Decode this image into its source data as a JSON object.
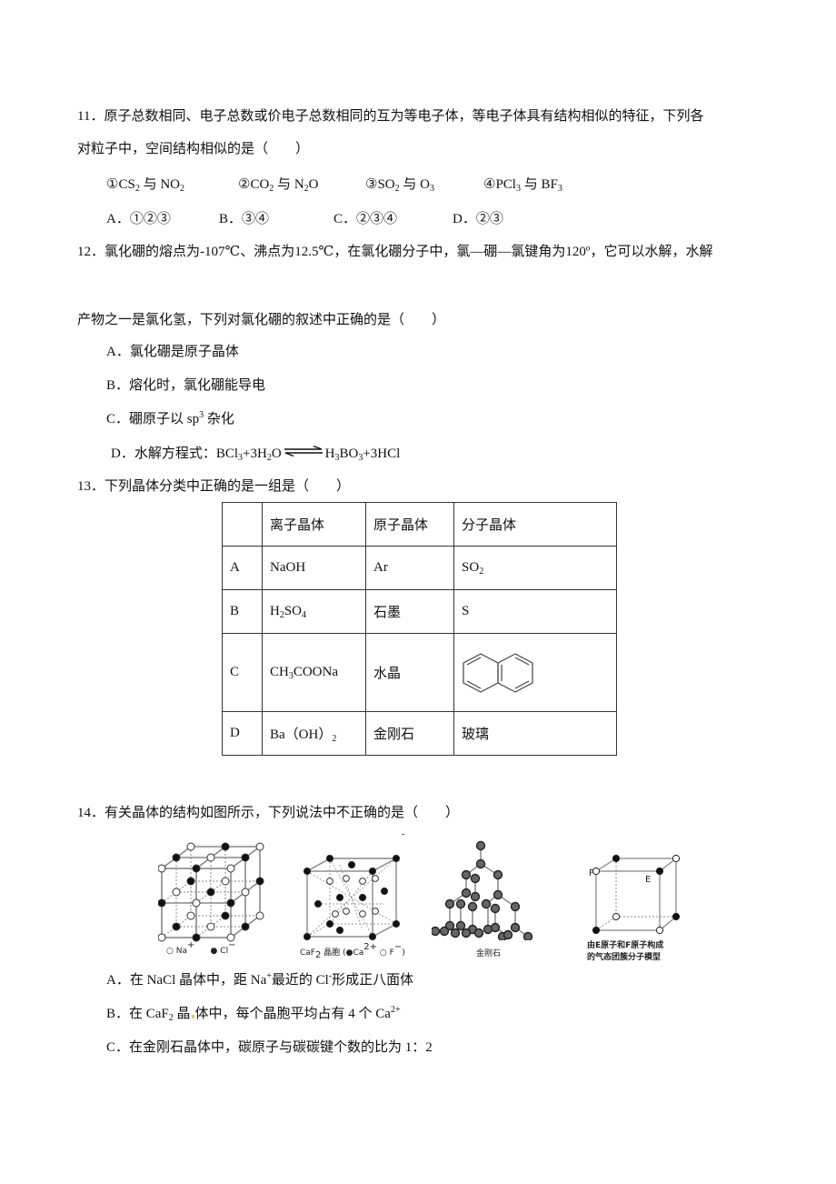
{
  "q11": {
    "number": "11．",
    "line1": "原子总数相同、电子总数或价电子总数相同的互为等电子体，等电子体具有结构相似的特征，下列各",
    "line2": "对粒子中，空间结构相似的是（　　）",
    "pairs": [
      {
        "mark": "①",
        "a": "CS",
        "a_sub": "2",
        "sep": "与",
        "b": "NO",
        "b_sub": "2"
      },
      {
        "mark": "②",
        "a": "CO",
        "a_sub": "2",
        "sep": "与",
        "b": "N",
        "b_sub": "2",
        "b_tail": "O"
      },
      {
        "mark": "③",
        "a": "SO",
        "a_sub": "2",
        "sep": "与",
        "b": "O",
        "b_sub": "3"
      },
      {
        "mark": "④",
        "a": "PCl",
        "a_sub": "3",
        "sep": "与",
        "b": "BF",
        "b_sub": "3"
      }
    ],
    "options": [
      {
        "label": "A．",
        "text": "①②③"
      },
      {
        "label": "B．",
        "text": "③④"
      },
      {
        "label": "C．",
        "text": "②③④"
      },
      {
        "label": "D．",
        "text": "②③"
      }
    ]
  },
  "q12": {
    "number": "12．",
    "line1": "氯化硼的熔点为-107℃、沸点为12.5℃，在氯化硼分子中，氯—硼—氯键角为120º，它可以水解，水解",
    "line2": "产物之一是氯化氢，下列对氯化硼的叙述中正确的是（　　）",
    "optA": "A．氯化硼是原子晶体",
    "optB": "B．熔化时，氯化硼能导电",
    "optC_pre": "C．硼原子以 sp",
    "optC_sup": "3",
    "optC_post": " 杂化",
    "optD_pre": "D．水解方程式：BCl",
    "optD_s1": "3",
    "optD_mid1": "+3H",
    "optD_s2": "2",
    "optD_mid2": "O",
    "optD_prod1": "H",
    "optD_s3": "3",
    "optD_prod2": "BO",
    "optD_s4": "3",
    "optD_prod3": "+3HCl"
  },
  "q13": {
    "number": "13．",
    "text": "下列晶体分类中正确的是一组是（　　）",
    "table": {
      "headers": [
        "",
        "离子晶体",
        "原子晶体",
        "分子晶体"
      ],
      "rows": [
        {
          "label": "A",
          "ionic": "NaOH",
          "atomic": "Ar",
          "molecular": "SO",
          "molecular_sub": "2"
        },
        {
          "label": "B",
          "ionic": "H",
          "ionic_sub1": "2",
          "ionic_mid": "SO",
          "ionic_sub2": "4",
          "atomic": "石墨",
          "molecular": "S"
        },
        {
          "label": "C",
          "ionic": "CH",
          "ionic_sub1": "3",
          "ionic_mid": "COONa",
          "atomic": "水晶",
          "molecular_icon": "naphthalene-structure"
        },
        {
          "label": "D",
          "ionic": "Ba（OH）",
          "ionic_sub1": "2",
          "atomic": "金刚石",
          "molecular": "玻璃"
        }
      ]
    }
  },
  "q14": {
    "number": "14．",
    "text": "有关晶体的结构如图所示，下列说法中不正确的是（　　）",
    "figures": [
      {
        "name": "nacl-crystal",
        "legend_na": "Na",
        "legend_na_sup": "+",
        "legend_cl": "Cl",
        "legend_cl_sup": "−"
      },
      {
        "name": "caf2-unit-cell",
        "caption_pre": "CaF",
        "caption_sub": "2",
        "caption_mid": " 晶胞 (",
        "caption_ca": "Ca",
        "caption_ca_sup": "2+",
        "caption_f": "F",
        "caption_f_sup": "−",
        "caption_end": ")"
      },
      {
        "name": "diamond",
        "caption": "金刚石"
      },
      {
        "name": "ef-cluster",
        "label_f": "F",
        "label_e": "E",
        "caption1": "由E原子和F原子构成",
        "caption2": "的气态团簇分子模型"
      }
    ],
    "optA_pre": "A．在 NaCl 晶体中，距 Na",
    "optA_sup1": "+",
    "optA_mid": "最近的 Cl",
    "optA_sup2": "-",
    "optA_post": "形成正八面体",
    "optB_pre": "B．在 CaF",
    "optB_sub": "2",
    "optB_mid1": " 晶",
    "optB_mid2": "体中，每个晶胞平均占有 4 个 Ca",
    "optB_sup": "2+",
    "optC": "C．在金刚石晶体中，碳原子与碳碳键个数的比为 1：2"
  }
}
